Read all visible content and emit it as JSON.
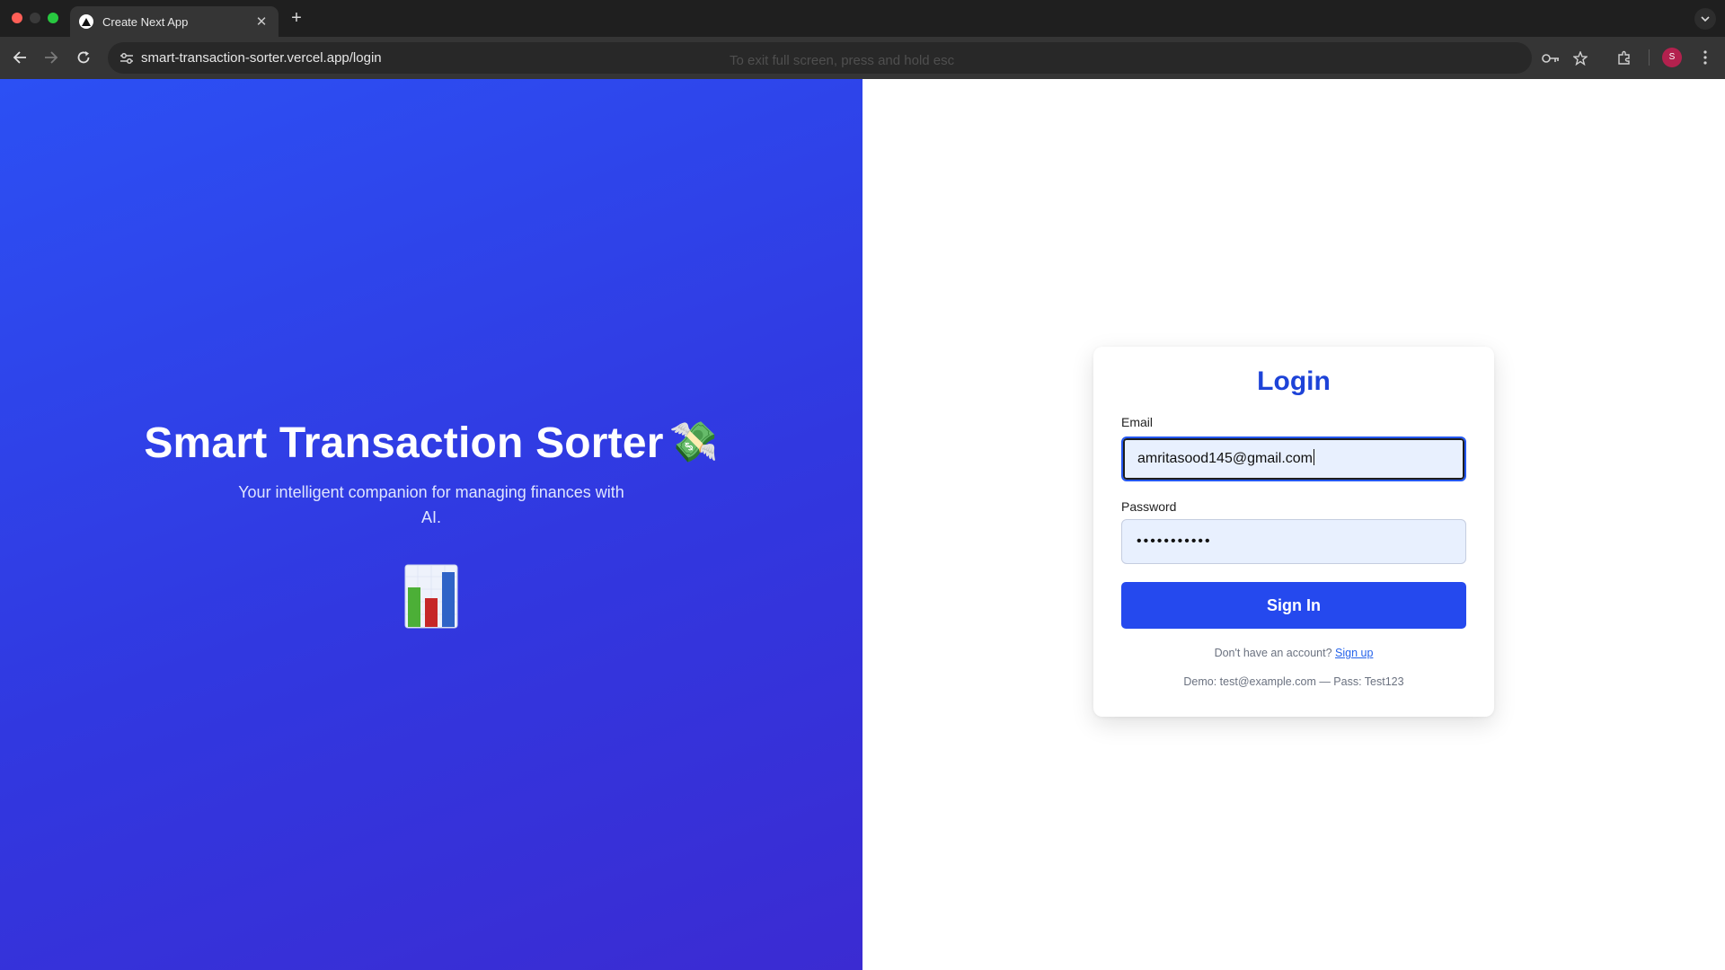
{
  "browser": {
    "tab_title": "Create Next App",
    "url": "smart-transaction-sorter.vercel.app/login",
    "fullscreen_hint": "To exit full screen, press and hold  esc",
    "avatar_initial": "S"
  },
  "hero": {
    "title": "Smart Transaction Sorter",
    "title_emoji": "💸",
    "subtitle": "Your intelligent companion for managing finances with AI.",
    "image_icon": "bar-chart-emoji"
  },
  "login": {
    "title": "Login",
    "email_label": "Email",
    "email_value": "amritasood145@gmail.com",
    "password_label": "Password",
    "password_value": "•••••••••••",
    "submit_label": "Sign In",
    "signup_prompt": "Don't have an account?",
    "signup_link": "Sign up",
    "demo_text": "Demo: test@example.com — Pass: Test123"
  },
  "colors": {
    "hero_gradient_start": "#2c50f4",
    "hero_gradient_end": "#3b2bd2",
    "accent": "#2549ee",
    "title": "#1d43d8",
    "input_bg": "#e8f0fe"
  }
}
